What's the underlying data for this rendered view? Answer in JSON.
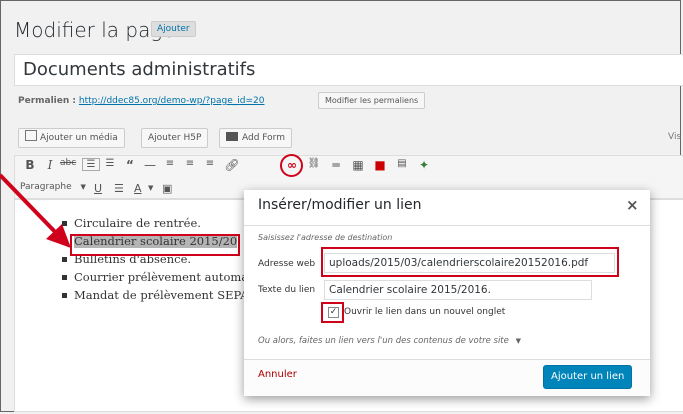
{
  "header": {
    "title": "Modifier la page",
    "add_new": "Ajouter"
  },
  "post_title": "Documents administratifs",
  "permalink": {
    "label": "Permalien :",
    "url": "http://ddec85.org/demo-wp/?page_id=20",
    "edit_button": "Modifier les permaliens"
  },
  "media_buttons": {
    "add_media": "Ajouter un média",
    "add_h5p": "Ajouter H5P",
    "add_form": "Add Form"
  },
  "editor_tabs": {
    "visual": "Vis"
  },
  "toolbar": {
    "format_select": "Paragraphe"
  },
  "content": {
    "items": [
      "Circulaire de rentrée.",
      "Calendrier scolaire 2015/20",
      "Bulletins d'absence.",
      "Courrier prélèvement automa",
      "Mandat de prélèvement SEPA"
    ]
  },
  "link_dialog": {
    "title": "Insérer/modifier un lien",
    "hint": "Saisissez l'adresse de destination",
    "url_label": "Adresse web",
    "url_value": "uploads/2015/03/calendrierscolaire20152016.pdf",
    "text_label": "Texte du lien",
    "text_value": "Calendrier scolaire 2015/2016.",
    "new_tab_label": "Ouvrir le lien dans un nouvel onglet",
    "new_tab_checked": true,
    "alt_link_text": "Ou alors, faites un lien vers l'un des contenus de votre site",
    "cancel": "Annuler",
    "submit": "Ajouter un lien"
  },
  "colors": {
    "highlight": "#d0021b",
    "primary_button": "#0085ba",
    "link": "#0073aa"
  }
}
